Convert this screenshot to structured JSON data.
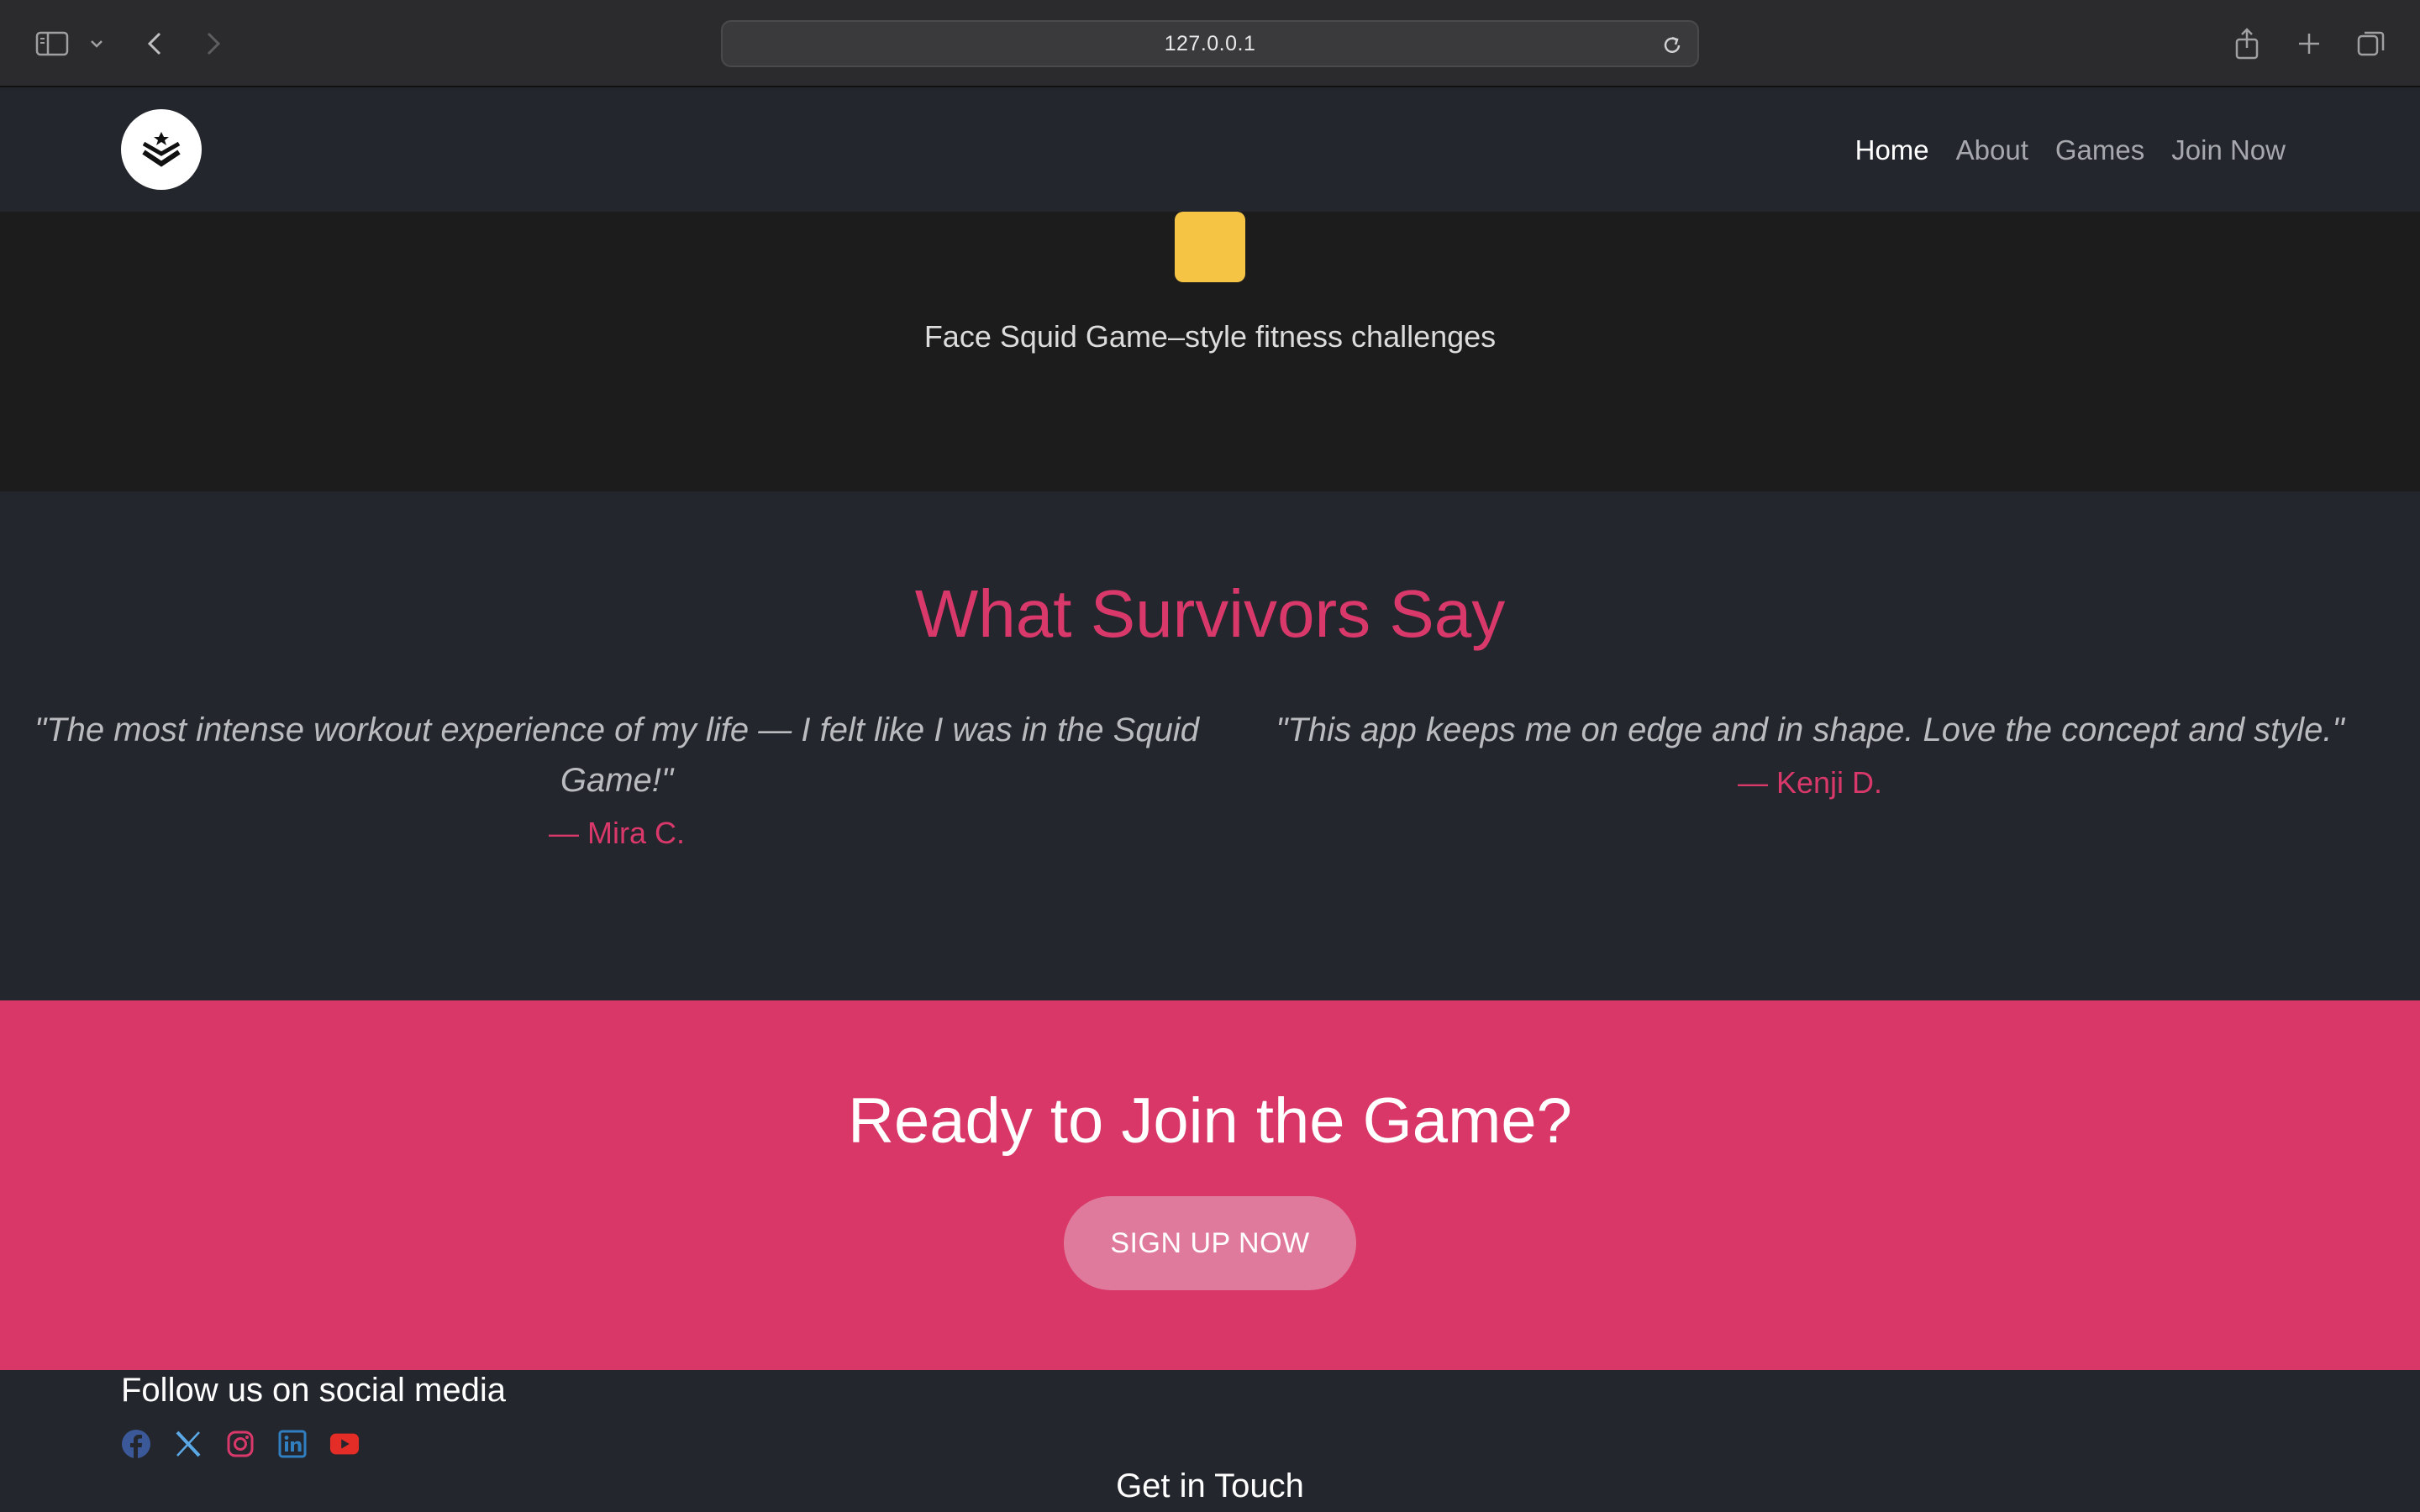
{
  "browser": {
    "url": "127.0.0.1"
  },
  "navbar": {
    "links": [
      {
        "label": "Home",
        "active": true
      },
      {
        "label": "About",
        "active": false
      },
      {
        "label": "Games",
        "active": false
      },
      {
        "label": "Join Now",
        "active": false
      }
    ]
  },
  "hero": {
    "text": "Face Squid Game–style fitness challenges",
    "accent_color": "#f6c445"
  },
  "testimonials": {
    "title": "What Survivors Say",
    "items": [
      {
        "quote": "\"The most intense workout experience of my life — I felt like I was in the Squid Game!\"",
        "author": "— Mira C."
      },
      {
        "quote": "\"This app keeps me on edge and in shape. Love the concept and style.\"",
        "author": "— Kenji D."
      }
    ]
  },
  "cta": {
    "title": "Ready to Join the Game?",
    "button_label": "SIGN UP NOW",
    "background_color": "#d83767"
  },
  "footer": {
    "follow_title": "Follow us on social media",
    "socials": [
      "facebook-icon",
      "x-icon",
      "instagram-icon",
      "linkedin-icon",
      "youtube-icon"
    ],
    "contact_title": "Get in Touch"
  }
}
